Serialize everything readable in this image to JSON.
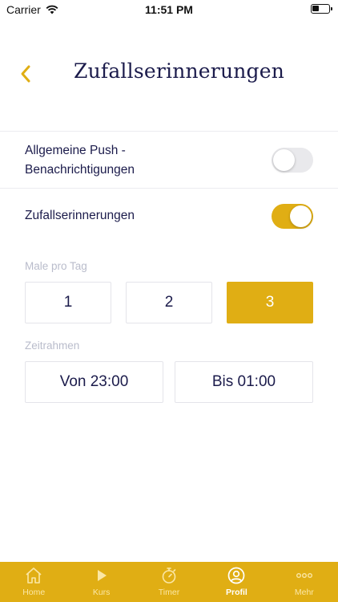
{
  "status_bar": {
    "carrier": "Carrier",
    "time": "11:51 PM"
  },
  "header": {
    "title": "Zufallserinnerungen"
  },
  "settings": {
    "push_label_line1": "Allgemeine Push -",
    "push_label_line2": "Benachrichtigungen",
    "push_enabled": false,
    "random_label": "Zufallserinnerungen",
    "random_enabled": true
  },
  "times_per_day": {
    "label": "Male pro Tag",
    "options": [
      "1",
      "2",
      "3"
    ],
    "selected": "3"
  },
  "timeframe": {
    "label": "Zeitrahmen",
    "from": "Von 23:00",
    "to": "Bis 01:00"
  },
  "tab_bar": {
    "tabs": [
      {
        "label": "Home",
        "icon": "home-icon"
      },
      {
        "label": "Kurs",
        "icon": "play-icon"
      },
      {
        "label": "Timer",
        "icon": "stopwatch-icon"
      },
      {
        "label": "Profil",
        "icon": "profile-icon"
      },
      {
        "label": "Mehr",
        "icon": "more-icon"
      }
    ],
    "active": "Profil"
  },
  "colors": {
    "accent": "#e0ae14",
    "text": "#1b1b4b",
    "muted": "#b9bccb"
  }
}
